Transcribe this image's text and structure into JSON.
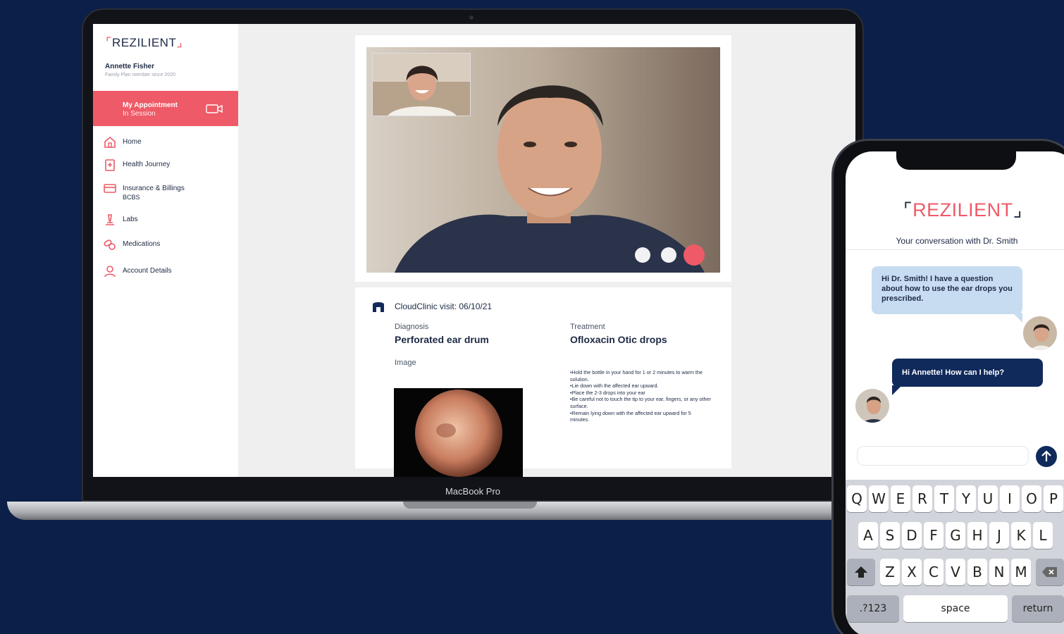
{
  "laptop": {
    "model_label": "MacBook Pro",
    "brand": {
      "name": "REZILIENT"
    },
    "user": {
      "name": "Annette Fisher",
      "subtitle": "Family Plan member since 2020"
    },
    "appointment": {
      "title": "My Appointment",
      "status": "In Session",
      "icon": "video-camera-icon"
    },
    "nav": [
      {
        "label": "Home",
        "icon": "home-icon"
      },
      {
        "label": "Health Journey",
        "icon": "clipboard-icon"
      },
      {
        "label": "Insurance & Billings",
        "sub": "BCBS",
        "icon": "credit-card-icon"
      },
      {
        "label": "Labs",
        "icon": "microscope-icon"
      },
      {
        "label": "Medications",
        "icon": "pills-icon"
      },
      {
        "label": "Account Details",
        "icon": "user-icon"
      }
    ],
    "video_controls": [
      "mute-button",
      "camera-toggle-button",
      "end-call-button"
    ],
    "visit": {
      "title": "CloudClinic visit: 06/10/21",
      "diagnosis_label": "Diagnosis",
      "diagnosis": "Perforated ear drum",
      "image_label": "Image",
      "treatment_label": "Treatment",
      "treatment": "Ofloxacin Otic drops",
      "instructions": [
        "•Hold the bottle in your hand for 1 or 2 minutes to warm the solution.",
        "•Lie down with the affected ear upward.",
        "•Place the 2-3 drops into your ear",
        "•Be careful not to touch the tip to your ear, fingers, or any other surface.",
        "•Remain lying down with the affected ear upward for 5 minutes."
      ]
    }
  },
  "phone": {
    "brand": "REZILIENT",
    "conversation_title": "Your conversation with Dr. Smith",
    "messages": [
      {
        "from": "patient",
        "text": "Hi Dr. Smith! I have a question about how to use the ear drops you prescribed."
      },
      {
        "from": "doctor",
        "text": "Hi Annette! How can I help?"
      }
    ],
    "input_placeholder": "",
    "keyboard": {
      "row1": [
        "Q",
        "W",
        "E",
        "R",
        "T",
        "Y",
        "U",
        "I",
        "O",
        "P"
      ],
      "row2": [
        "A",
        "S",
        "D",
        "F",
        "G",
        "H",
        "J",
        "K",
        "L"
      ],
      "row3": [
        "Z",
        "X",
        "C",
        "V",
        "B",
        "N",
        "M"
      ],
      "numbers_key": ".?123",
      "space_key": "space",
      "return_key": "return"
    }
  },
  "colors": {
    "background": "#0b1f48",
    "accent": "#ee5a67",
    "navy": "#102a5b",
    "bubble": "#c8dcf1"
  }
}
